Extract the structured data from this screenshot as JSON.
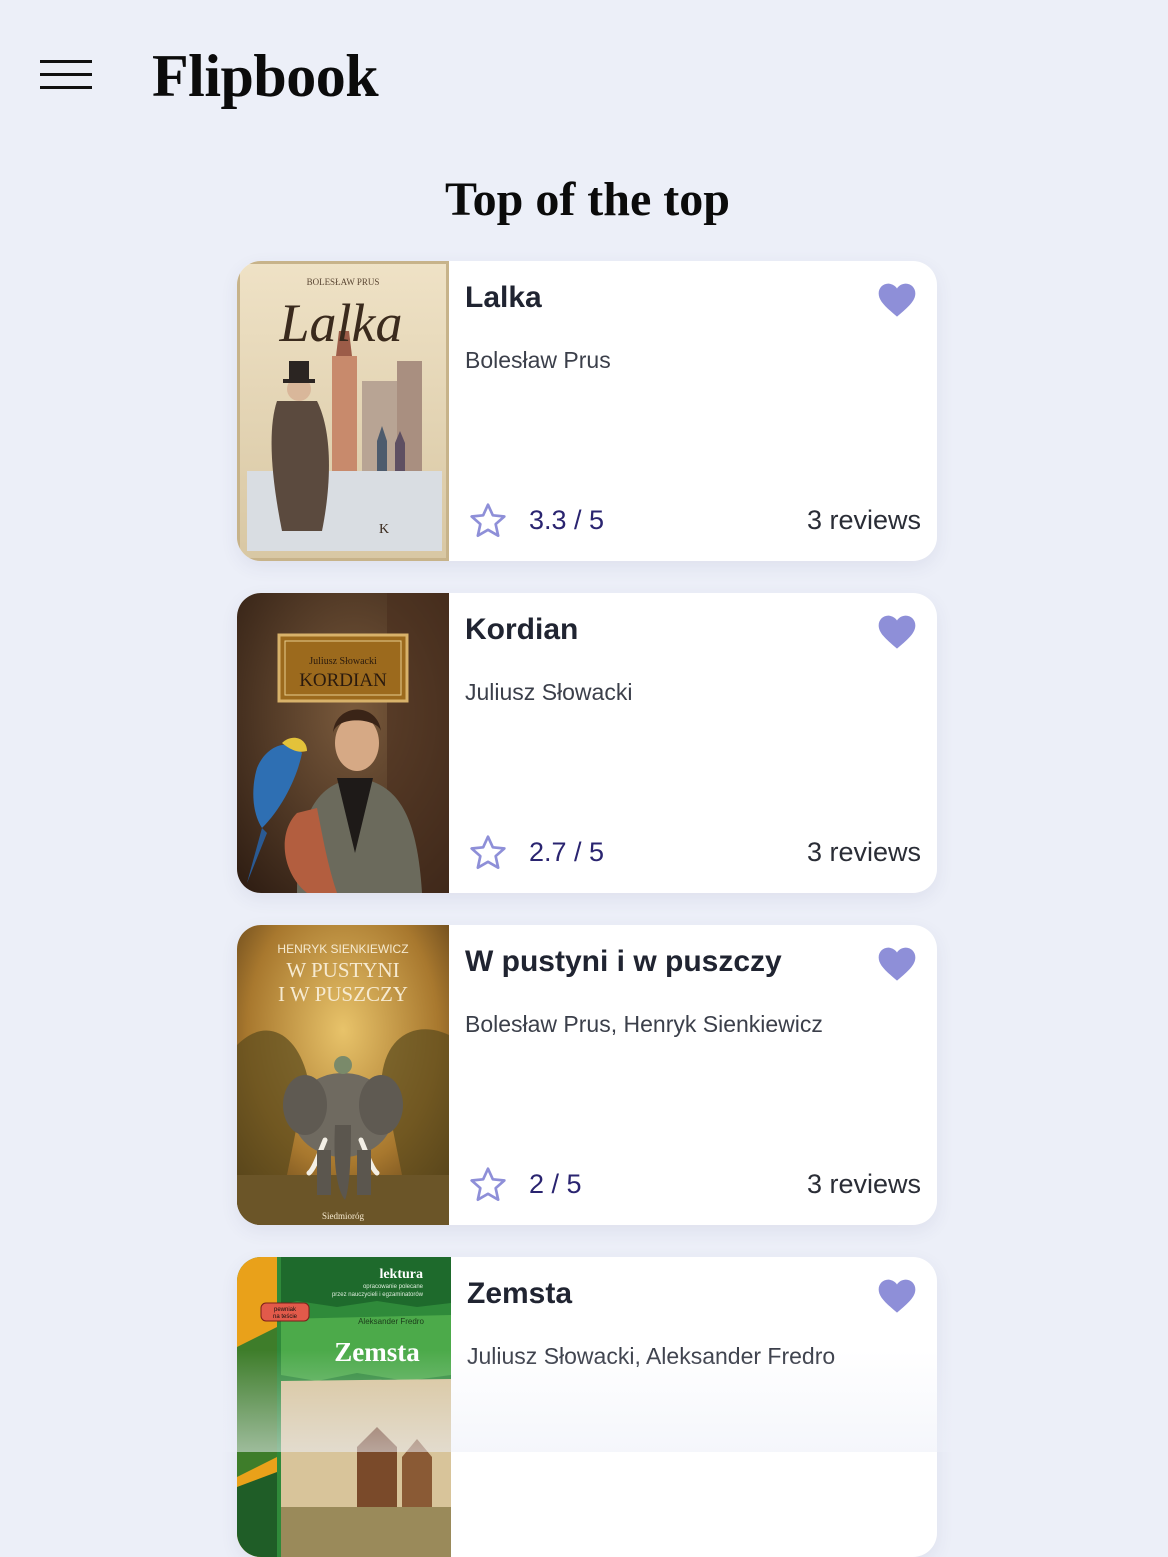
{
  "app": {
    "brand": "Flipbook"
  },
  "header": {
    "menu_icon": "hamburger-menu-icon"
  },
  "section": {
    "title": "Top of the top"
  },
  "accent_color": "#8e8fd8",
  "books": [
    {
      "title": "Lalka",
      "authors": "Bolesław Prus",
      "rating": "3.3 / 5",
      "reviews": "3 reviews",
      "cover": {
        "top_text": "BOLESŁAW PRUS",
        "title_text": "Lalka",
        "publisher_mark": "K"
      }
    },
    {
      "title": "Kordian",
      "authors": "Juliusz Słowacki",
      "rating": "2.7 / 5",
      "reviews": "3 reviews",
      "cover": {
        "author_text": "Juliusz Słowacki",
        "title_text": "KORDIAN"
      }
    },
    {
      "title": "W pustyni i w puszczy",
      "authors": "Bolesław Prus, Henryk Sienkiewicz",
      "rating": "2 / 5",
      "reviews": "3 reviews",
      "cover": {
        "author_text": "HENRYK SIENKIEWICZ",
        "title_line1": "W PUSTYNI",
        "title_line2": "I W PUSZCZY",
        "publisher": "Siedmioróg"
      }
    },
    {
      "title": "Zemsta",
      "authors": "Juliusz Słowacki, Aleksander Fredro",
      "rating": "",
      "reviews": "",
      "cover": {
        "series": "lektura",
        "series_sub1": "opracowanie polecane",
        "series_sub2": "przez nauczycieli i egzaminatorów",
        "badge_line1": "pewniak",
        "badge_line2": "na teście",
        "author_text": "Aleksander Fredro",
        "title_text": "Zemsta"
      }
    }
  ]
}
